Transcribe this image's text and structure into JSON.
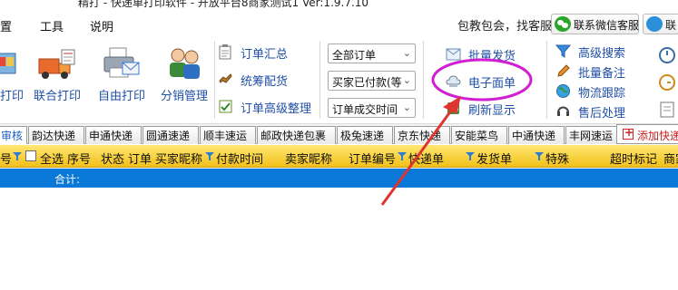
{
  "window": {
    "title": "精打 - 快递单打印软件 - 开放平台8商家测试1 Ver:1.9.7.10"
  },
  "menu": {
    "items": [
      "置",
      "工具",
      "说明"
    ]
  },
  "header_right": {
    "promo": "包教包会，找客服",
    "wechat_label": "联系微信客服",
    "second_label": "联"
  },
  "toolbar": {
    "big_buttons": [
      {
        "label": "打印",
        "icon": "print-icon"
      },
      {
        "label": "联合打印",
        "icon": "truck-icon"
      },
      {
        "label": "自由打印",
        "icon": "printer-mail-icon"
      },
      {
        "label": "分销管理",
        "icon": "users-icon"
      }
    ],
    "order_group": [
      {
        "label": "订单汇总",
        "icon": "clipboard-icon"
      },
      {
        "label": "统筹配货",
        "icon": "hand-icon"
      },
      {
        "label": "订单高级整理",
        "icon": "check-list-icon"
      }
    ],
    "filters": [
      {
        "value": "全部订单"
      },
      {
        "value": "买家已付款(等"
      },
      {
        "value": "订单成交时间"
      }
    ],
    "ship_group": [
      {
        "label": "批量发货",
        "icon": "ship-icon"
      },
      {
        "label": "电子面单",
        "icon": "cloud-icon"
      },
      {
        "label": "刷新显示",
        "icon": "refresh-icon"
      }
    ],
    "search_group": [
      {
        "label": "高级搜索",
        "icon": "funnel-icon"
      },
      {
        "label": "批量备注",
        "icon": "pen-icon"
      },
      {
        "label": "物流跟踪",
        "icon": "globe-icon"
      },
      {
        "label": "售后处理",
        "icon": "headset-icon"
      }
    ]
  },
  "carriers": {
    "tabs": [
      "审核",
      "韵达快递",
      "申通快递",
      "圆通速递",
      "顺丰速运",
      "邮政快递包裹",
      "极兔速递",
      "京东快递",
      "安能菜鸟",
      "中通快递",
      "丰网速运"
    ],
    "active_index": 0,
    "add_label": "添加快递"
  },
  "grid": {
    "columns": [
      "号",
      "全选",
      "序号",
      "状态",
      "订单",
      "买家昵称",
      "付款时间",
      "卖家昵称",
      "订单编号",
      "快递单",
      "发货单",
      "特殊",
      "超时标记",
      "商家"
    ],
    "summary_label": "合计:"
  },
  "colors": {
    "accent_blue": "#1f4fa6",
    "header_yellow": "#f2c01a",
    "summary_blue": "#0a78d6",
    "annotation_magenta": "#d21ed2",
    "annotation_red": "#e0352e"
  }
}
